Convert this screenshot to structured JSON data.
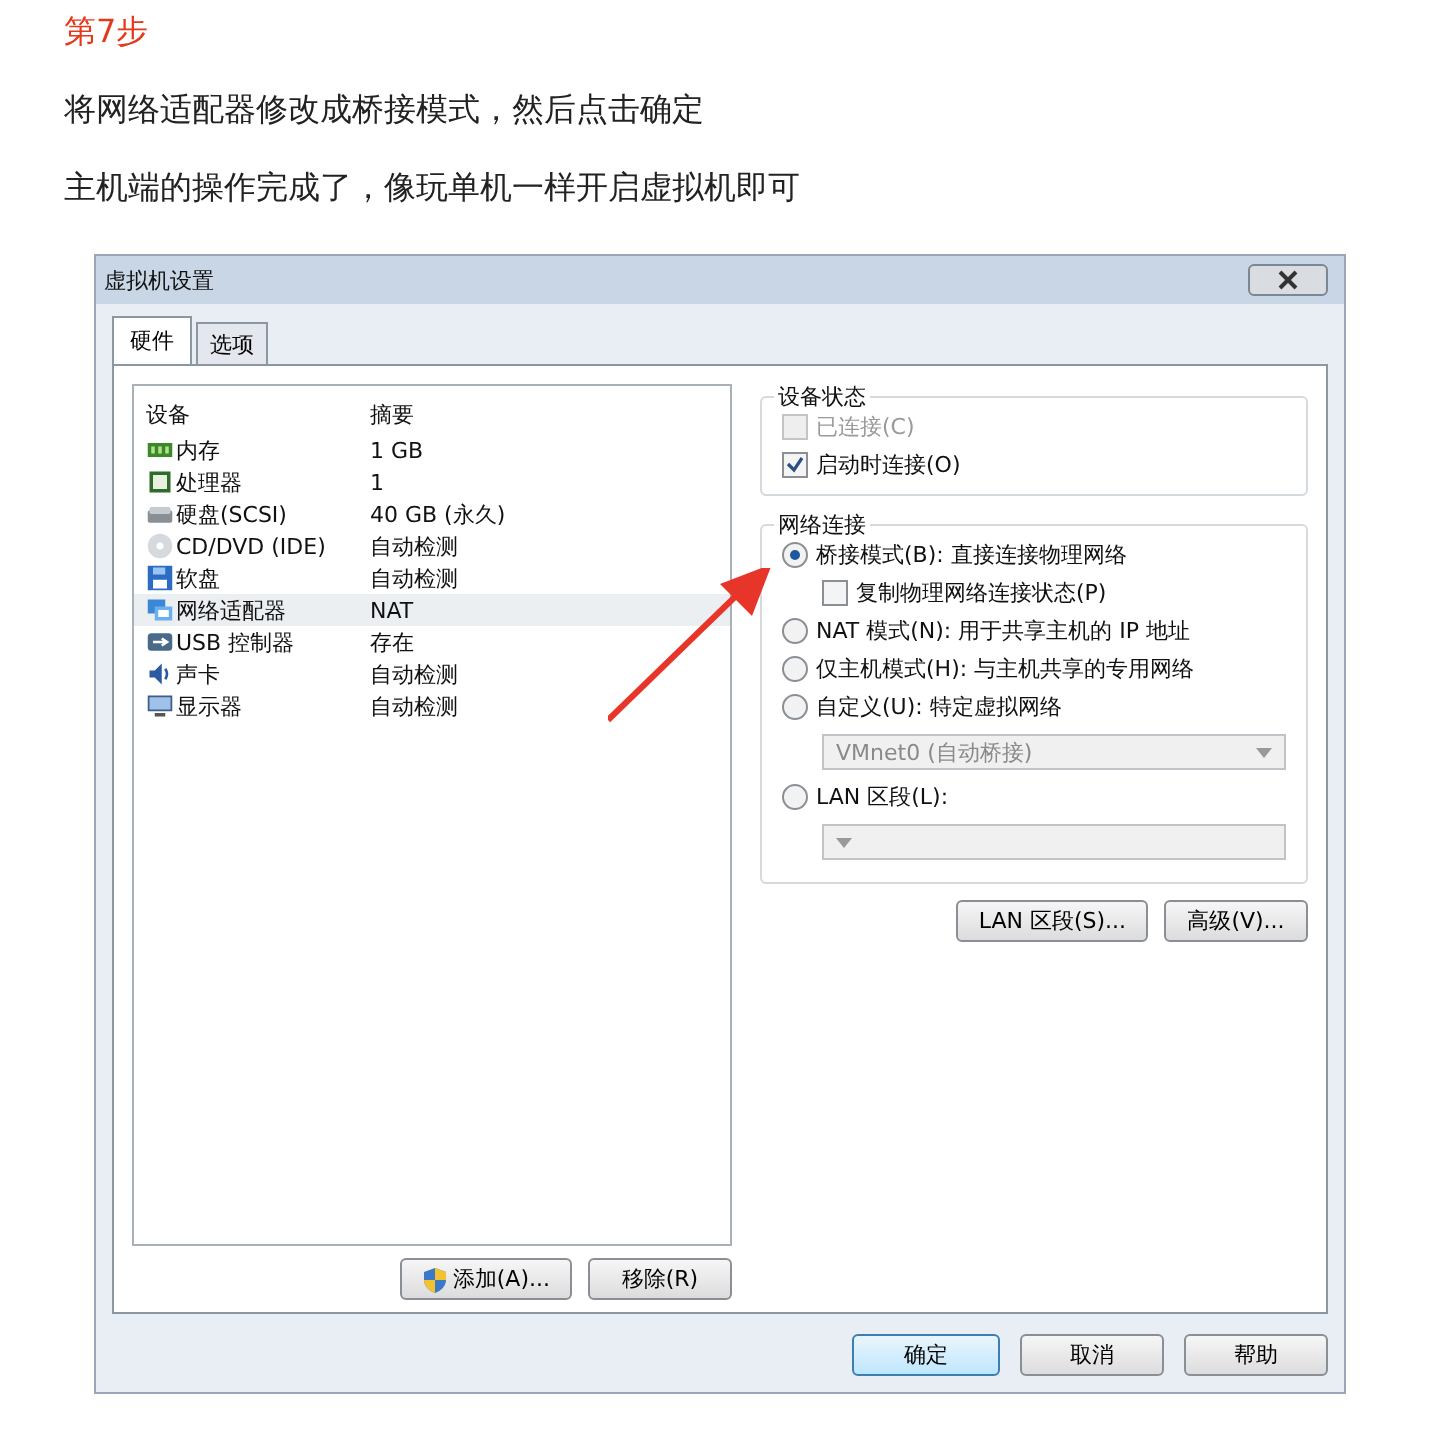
{
  "article": {
    "heading": "第7步",
    "paragraphs": [
      "将网络适配器修改成桥接模式，然后点击确定",
      "主机端的操作完成了，像玩单机一样开启虚拟机即可"
    ]
  },
  "dialog": {
    "title": "虚拟机设置",
    "tabs": [
      {
        "label": "硬件",
        "selected": true
      },
      {
        "label": "选项",
        "selected": false
      }
    ],
    "device_list": {
      "columns": [
        "设备",
        "摘要"
      ],
      "rows": [
        {
          "kind": "memory",
          "name": "内存",
          "summary": "1 GB",
          "selected": false
        },
        {
          "kind": "processor",
          "name": "处理器",
          "summary": "1",
          "selected": false
        },
        {
          "kind": "disk",
          "name": "硬盘(SCSI)",
          "summary": "40 GB (永久)",
          "selected": false
        },
        {
          "kind": "cd",
          "name": "CD/DVD (IDE)",
          "summary": "自动检测",
          "selected": false
        },
        {
          "kind": "floppy",
          "name": "软盘",
          "summary": "自动检测",
          "selected": false
        },
        {
          "kind": "network",
          "name": "网络适配器",
          "summary": "NAT",
          "selected": true
        },
        {
          "kind": "usb",
          "name": "USB 控制器",
          "summary": "存在",
          "selected": false
        },
        {
          "kind": "sound",
          "name": "声卡",
          "summary": "自动检测",
          "selected": false
        },
        {
          "kind": "display",
          "name": "显示器",
          "summary": "自动检测",
          "selected": false
        }
      ]
    },
    "list_buttons": [
      "添加(A)...",
      "移除(R)"
    ],
    "device_status": {
      "title": "设备状态",
      "options": [
        {
          "label": "已连接(C)",
          "checked": false,
          "disabled": true
        },
        {
          "label": "启动时连接(O)",
          "checked": true,
          "disabled": false
        }
      ]
    },
    "network_connection": {
      "title": "网络连接",
      "items": [
        {
          "kind": "radio",
          "label": "桥接模式(B): 直接连接物理网络",
          "selected": true
        },
        {
          "kind": "checkbox",
          "label": "复制物理网络连接状态(P)",
          "checked": false
        },
        {
          "kind": "radio",
          "label": "NAT 模式(N): 用于共享主机的 IP 地址",
          "selected": false
        },
        {
          "kind": "radio",
          "label": "仅主机模式(H): 与主机共享的专用网络",
          "selected": false
        },
        {
          "kind": "radio",
          "label": "自定义(U): 特定虚拟网络",
          "selected": false
        },
        {
          "kind": "dropdown",
          "value": "VMnet0 (自动桥接)",
          "disabled": true
        },
        {
          "kind": "radio",
          "label": "LAN 区段(L):",
          "selected": false
        },
        {
          "kind": "dropdown",
          "disabled": true
        }
      ]
    },
    "side_buttons": [
      "LAN 区段(S)...",
      "高级(V)..."
    ],
    "footer_buttons": [
      {
        "label": "确定",
        "default": true
      },
      {
        "label": "取消",
        "default": false
      },
      {
        "label": "帮助",
        "default": false
      }
    ]
  }
}
